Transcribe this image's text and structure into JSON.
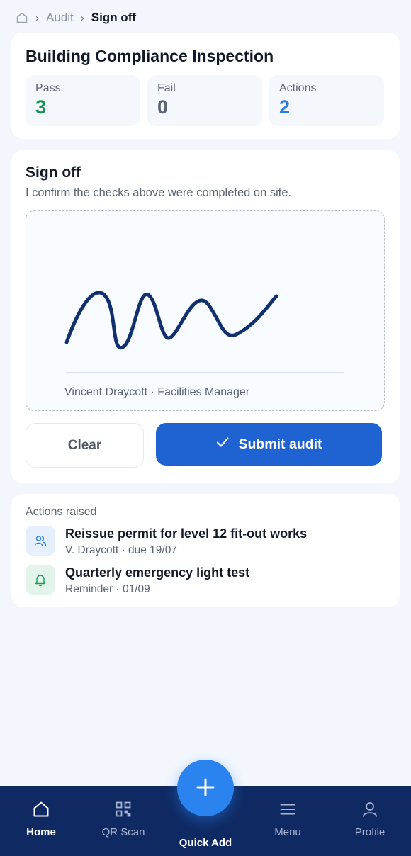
{
  "breadcrumb": {
    "items": [
      "Audit"
    ],
    "current": "Sign off"
  },
  "summary": {
    "title": "Building Compliance Inspection",
    "stats": [
      {
        "label": "Pass",
        "value": "3",
        "color": "#15924f"
      },
      {
        "label": "Fail",
        "value": "0",
        "color": "#5b6474"
      },
      {
        "label": "Actions",
        "value": "2",
        "color": "#2b7de0"
      }
    ]
  },
  "signoff": {
    "title": "Sign off",
    "description": "I confirm the checks above were completed on site.",
    "signer": "Vincent Draycott · Facilities Manager",
    "clear_label": "Clear",
    "submit_label": "Submit audit",
    "accent": "#1f63d3"
  },
  "actions_raised": {
    "title": "Actions raised",
    "items": [
      {
        "title": "Reissue permit for level 12 fit-out works",
        "meta": "V. Draycott · due 19/07",
        "icon": "users-icon"
      },
      {
        "title": "Quarterly emergency light test",
        "meta": "Reminder · 01/09",
        "icon": "bell-icon"
      }
    ]
  },
  "nav": {
    "items": [
      {
        "label": "Home",
        "icon": "home-icon",
        "active": true
      },
      {
        "label": "QR Scan",
        "icon": "qr-icon",
        "active": false
      },
      {
        "label": "Menu",
        "icon": "menu-icon",
        "active": false
      },
      {
        "label": "Profile",
        "icon": "profile-icon",
        "active": false
      }
    ],
    "fab_label": "Quick Add",
    "background": "#0f2a63"
  }
}
